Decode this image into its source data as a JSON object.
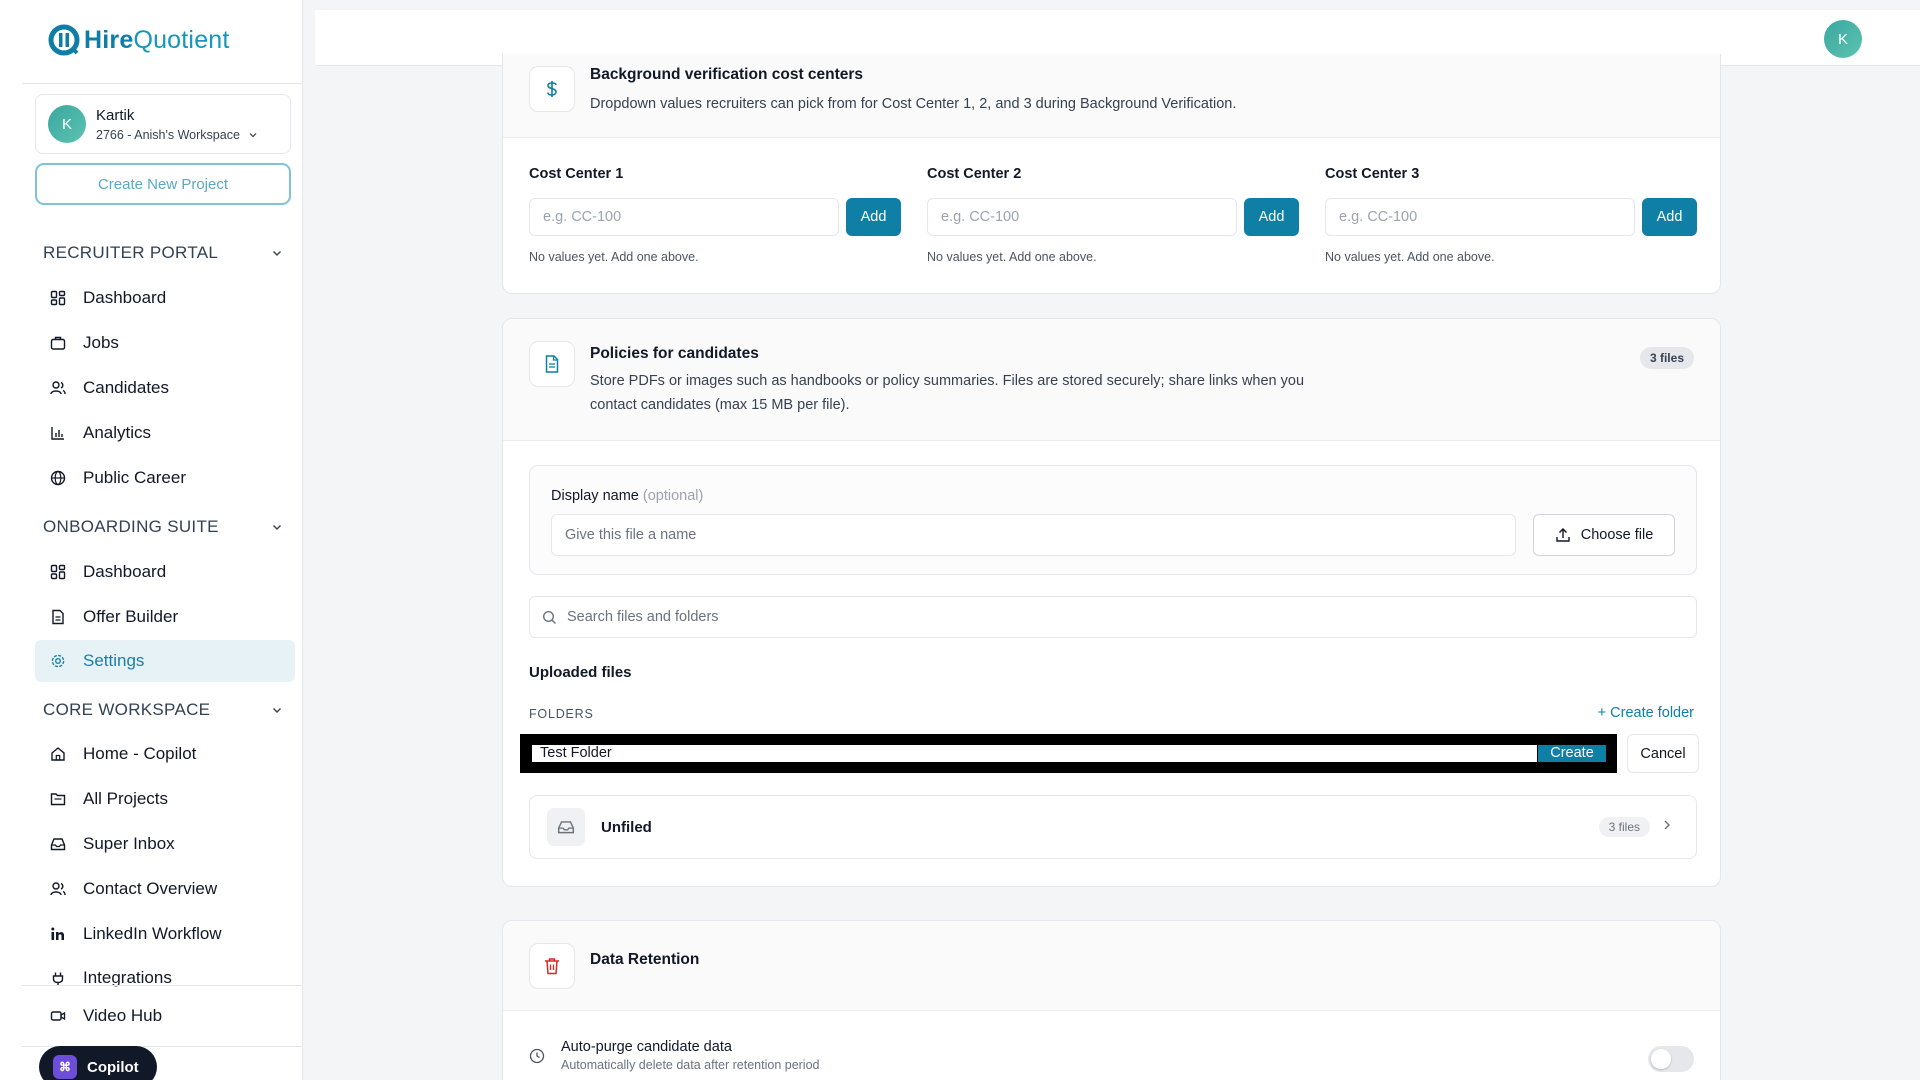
{
  "brand": {
    "name_bold": "Hire",
    "name_light": "Quotient"
  },
  "workspace": {
    "avatar_letter": "K",
    "user": "Kartik",
    "name": "2766 - Anish's Workspace"
  },
  "create_project_label": "Create New Project",
  "sidebar": {
    "recruiter_portal": {
      "title": "RECRUITER PORTAL",
      "items": [
        {
          "label": "Dashboard",
          "icon": "grid-icon"
        },
        {
          "label": "Jobs",
          "icon": "briefcase-icon"
        },
        {
          "label": "Candidates",
          "icon": "users-icon"
        },
        {
          "label": "Analytics",
          "icon": "bar-chart-icon"
        },
        {
          "label": "Public Career",
          "icon": "globe-icon"
        }
      ]
    },
    "onboarding_suite": {
      "title": "ONBOARDING SUITE",
      "items": [
        {
          "label": "Dashboard",
          "icon": "grid-icon"
        },
        {
          "label": "Offer Builder",
          "icon": "document-icon"
        },
        {
          "label": "Settings",
          "icon": "gear-icon",
          "active": true
        }
      ]
    },
    "core_workspace": {
      "title": "CORE WORKSPACE",
      "items": [
        {
          "label": "Home - Copilot",
          "icon": "home-icon"
        },
        {
          "label": "All Projects",
          "icon": "folder-icon"
        },
        {
          "label": "Super Inbox",
          "icon": "inbox-icon"
        },
        {
          "label": "Contact Overview",
          "icon": "users-icon"
        },
        {
          "label": "LinkedIn Workflow",
          "icon": "linkedin-icon"
        },
        {
          "label": "Integrations",
          "icon": "plug-icon"
        }
      ]
    },
    "video_hub": {
      "label": "Video Hub",
      "icon": "video-icon"
    },
    "copilot_label": "Copilot"
  },
  "topbar": {
    "avatar_letter": "K"
  },
  "cost_centers": {
    "title": "Background verification cost centers",
    "description": "Dropdown values recruiters can pick from for Cost Center 1, 2, and 3 during Background Verification.",
    "fields": [
      {
        "label": "Cost Center 1",
        "placeholder": "e.g. CC-100",
        "button": "Add",
        "hint": "No values yet. Add one above."
      },
      {
        "label": "Cost Center 2",
        "placeholder": "e.g. CC-100",
        "button": "Add",
        "hint": "No values yet. Add one above."
      },
      {
        "label": "Cost Center 3",
        "placeholder": "e.g. CC-100",
        "button": "Add",
        "hint": "No values yet. Add one above."
      }
    ]
  },
  "policies": {
    "title": "Policies for candidates",
    "description_line1": "Store PDFs or images such as handbooks or policy summaries. Files are stored securely; share links when you",
    "description_line2": "contact candidates (max 15 MB per file).",
    "badge": "3 files",
    "display_name_label": "Display name",
    "display_name_optional": "(optional)",
    "display_name_placeholder": "Give this file a name",
    "choose_file": "Choose file",
    "search_placeholder": "Search files and folders",
    "uploaded_title": "Uploaded files",
    "folders_label": "FOLDERS",
    "create_folder": "Create folder",
    "new_folder_value": "Test Folder",
    "create_button": "Create",
    "cancel_button": "Cancel",
    "unfiled": {
      "name": "Unfiled",
      "count": "3 files"
    }
  },
  "retention": {
    "title": "Data Retention",
    "auto_purge_title": "Auto-purge candidate data",
    "auto_purge_desc": "Automatically delete data after retention period"
  },
  "colors": {
    "accent": "#0f7fa6",
    "active_bg": "#e6f2f6",
    "danger": "#dc2626"
  }
}
